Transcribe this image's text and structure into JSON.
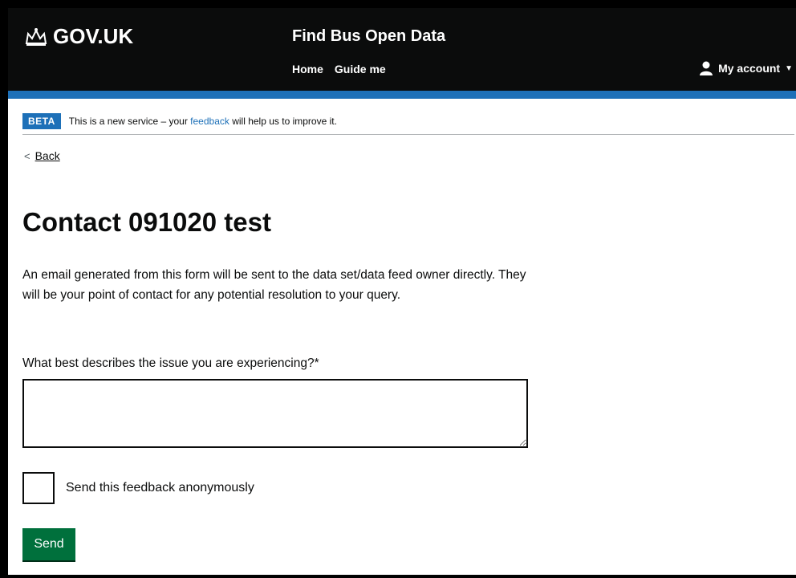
{
  "header": {
    "logo_text": "GOV.UK",
    "service_name": "Find Bus Open Data",
    "nav": [
      "Home",
      "Guide me"
    ],
    "account_label": "My account"
  },
  "phase": {
    "tag": "BETA",
    "text_before": "This is a new service – your ",
    "link": "feedback",
    "text_after": " will help us to improve it."
  },
  "back_link": "Back",
  "title": "Contact 091020 test",
  "lead": "An email generated from this form will be sent to the data set/data feed owner directly. They will be your point of contact for any potential resolution to your query.",
  "form": {
    "question_label": "What best describes the issue you are experiencing?*",
    "textarea_value": "",
    "anonymous_label": "Send this feedback anonymously",
    "anonymous_checked": false,
    "submit_label": "Send"
  },
  "colors": {
    "header_bg": "#0b0c0c",
    "accent_blue": "#1d70b8",
    "button_green": "#00703c"
  },
  "icons": [
    "crown-icon",
    "user-icon",
    "caret-down-icon",
    "chevron-left-icon"
  ]
}
